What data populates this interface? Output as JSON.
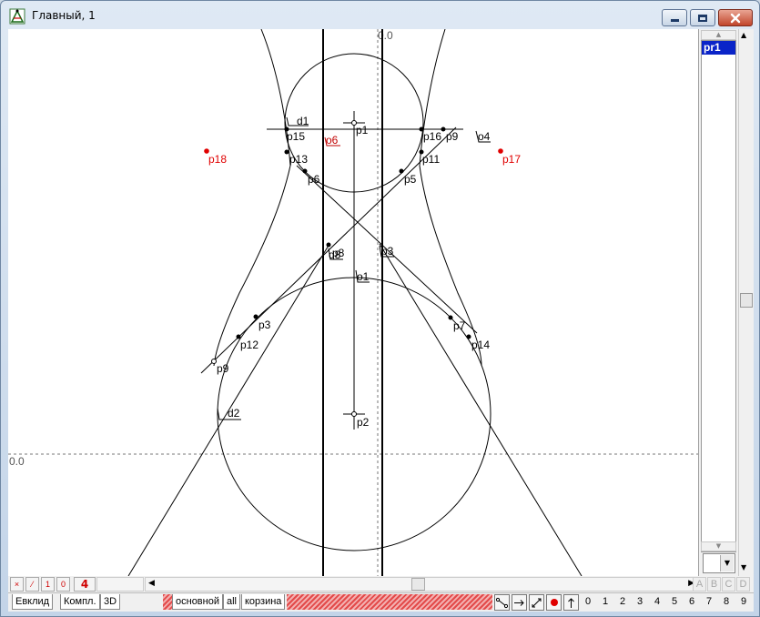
{
  "window": {
    "title": "Главный, 1",
    "icon": "geometry-app-icon"
  },
  "canvas": {
    "axis_label_x": "0.0",
    "axis_label_y": "0.0",
    "points": [
      {
        "id": "p1",
        "label": "p1",
        "kind": "cross"
      },
      {
        "id": "p2",
        "label": "p2",
        "kind": "cross"
      },
      {
        "id": "p3a",
        "label": "p3",
        "kind": "dot"
      },
      {
        "id": "p3b",
        "label": "p3",
        "kind": "tick"
      },
      {
        "id": "p4",
        "label": "p4",
        "kind": "dot"
      },
      {
        "id": "p5",
        "label": "p5",
        "kind": "dot"
      },
      {
        "id": "p6",
        "label": "p6",
        "kind": "dot"
      },
      {
        "id": "p7",
        "label": "p7",
        "kind": "open"
      },
      {
        "id": "p8",
        "label": "p8",
        "kind": "dot"
      },
      {
        "id": "p9",
        "label": "p9",
        "kind": "dot"
      },
      {
        "id": "p11",
        "label": "p11",
        "kind": "dot"
      },
      {
        "id": "p12",
        "label": "p12",
        "kind": "dot"
      },
      {
        "id": "p13",
        "label": "p13",
        "kind": "dot"
      },
      {
        "id": "p14",
        "label": "p14",
        "kind": "dot"
      },
      {
        "id": "p15",
        "label": "p15",
        "kind": "dot"
      },
      {
        "id": "p16",
        "label": "p16",
        "kind": "dot"
      },
      {
        "id": "p17",
        "label": "p17",
        "kind": "red"
      },
      {
        "id": "p18",
        "label": "p18",
        "kind": "red"
      }
    ],
    "labels": {
      "d1": "d1",
      "d2": "d2",
      "d8": "d8",
      "o1": "o1",
      "o4": "o4",
      "o6": "o6"
    },
    "colors": {
      "red_point": "#e00000",
      "line": "#000000",
      "selection": "#0a24c8"
    }
  },
  "side_panel": {
    "list_items": [
      "pr1"
    ]
  },
  "bottom_toolbar": {
    "mini_buttons": [
      "×",
      "⁄",
      "1",
      "0"
    ],
    "counter": "4",
    "abcd": [
      "A",
      "B",
      "C",
      "D"
    ],
    "tabs_left": [
      "Евклид",
      "Компл.",
      "3D"
    ],
    "tabs_middle": [
      "основной",
      "all",
      "корзина"
    ],
    "tools": [
      "segment-tool-icon",
      "arrow-right-icon",
      "line-tool-icon",
      "red-dot-icon",
      "arrow-up-icon"
    ],
    "digits": [
      "0",
      "1",
      "2",
      "3",
      "4",
      "5",
      "6",
      "7",
      "8",
      "9"
    ]
  }
}
